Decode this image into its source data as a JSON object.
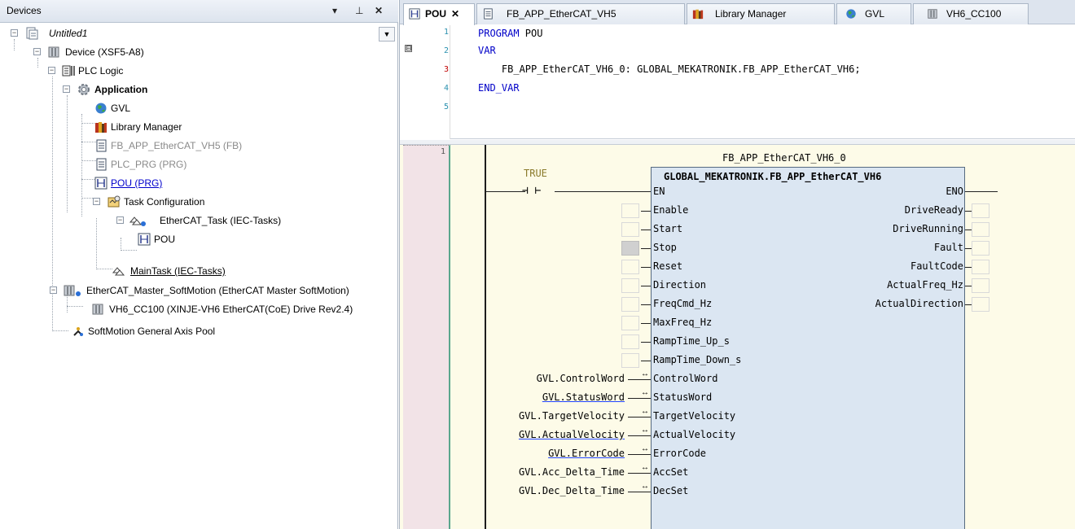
{
  "devices_panel": {
    "title": "Devices",
    "header_buttons": {
      "dropdown": "▾",
      "pin": "⊥",
      "close": "✕"
    },
    "tree": [
      {
        "label": "Untitled1",
        "icon": "project-icon"
      },
      {
        "label": "Device (XSF5-A8)",
        "icon": "device-icon"
      },
      {
        "label": "PLC Logic",
        "icon": "plc-logic-icon"
      },
      {
        "label": "Application",
        "icon": "application-gear-icon"
      },
      {
        "label": "GVL",
        "icon": "globe-icon"
      },
      {
        "label": "Library Manager",
        "icon": "library-books-icon"
      },
      {
        "label": "FB_APP_EtherCAT_VH5 (FB)",
        "icon": "document-icon"
      },
      {
        "label": "PLC_PRG (PRG)",
        "icon": "document-icon"
      },
      {
        "label": "POU (PRG)",
        "icon": "ladder-icon"
      },
      {
        "label": "Task Configuration",
        "icon": "task-config-icon"
      },
      {
        "label": "EtherCAT_Task (IEC-Tasks)",
        "icon": "task-icon"
      },
      {
        "label": "POU",
        "icon": "ladder-icon"
      },
      {
        "label": "MainTask (IEC-Tasks)",
        "icon": "task-icon"
      },
      {
        "label": "EtherCAT_Master_SoftMotion (EtherCAT Master SoftMotion)",
        "icon": "ethercat-master-icon"
      },
      {
        "label": "VH6_CC100 (XINJE-VH6 EtherCAT(CoE) Drive Rev2.4)",
        "icon": "device-icon"
      },
      {
        "label": "SoftMotion General Axis Pool",
        "icon": "axis-pool-icon"
      }
    ]
  },
  "tabs": [
    {
      "label": "POU",
      "close": "✕",
      "active": true,
      "icon": "ladder-icon"
    },
    {
      "label": "FB_APP_EtherCAT_VH5",
      "icon": "document-icon"
    },
    {
      "label": "Library Manager",
      "icon": "library-books-icon"
    },
    {
      "label": "GVL",
      "icon": "globe-icon"
    },
    {
      "label": "VH6_CC100",
      "icon": "device-icon"
    }
  ],
  "declaration": {
    "line_numbers": [
      "1",
      "2",
      "3",
      "4",
      "5"
    ],
    "fold_marker": "⊟",
    "lines": [
      {
        "kw": "PROGRAM",
        "rest": " POU"
      },
      {
        "kw": "VAR",
        "rest": ""
      },
      {
        "kw": "",
        "rest": "    FB_APP_EtherCAT_VH6_0: GLOBAL_MEKATRONIK.FB_APP_EtherCAT_VH6;"
      },
      {
        "kw": "END_VAR",
        "rest": ""
      },
      {
        "kw": "",
        "rest": ""
      }
    ]
  },
  "implementation": {
    "network_number": "1",
    "contact_label": "TRUE",
    "contact_glyph": "⊣ ⊢",
    "fb_instance": "FB_APP_EtherCAT_VH6_0",
    "fb_type": "GLOBAL_MEKATRONIK.FB_APP_EtherCAT_VH6",
    "inputs": [
      "EN",
      "Enable",
      "Start",
      "Stop",
      "Reset",
      "Direction",
      "FreqCmd_Hz",
      "MaxFreq_Hz",
      "RampTime_Up_s",
      "RampTime_Down_s",
      "ControlWord",
      "StatusWord",
      "TargetVelocity",
      "ActualVelocity",
      "ErrorCode",
      "AccSet",
      "DecSet"
    ],
    "outputs": [
      "ENO",
      "DriveReady",
      "DriveRunning",
      "Fault",
      "FaultCode",
      "ActualFreq_Hz",
      "ActualDirection"
    ],
    "inout_arrow": "↔",
    "inout_vars": [
      "GVL.ControlWord",
      "GVL.StatusWord",
      "GVL.TargetVelocity",
      "GVL.ActualVelocity",
      "GVL.ErrorCode",
      "GVL.Acc_Delta_Time",
      "GVL.Dec_Delta_Time"
    ]
  },
  "colors": {
    "keyword": "#0000c8",
    "fb_fill": "#dbe6f2",
    "canvas": "#fdfbe8",
    "gutter_pink": "#f2e3e7"
  }
}
